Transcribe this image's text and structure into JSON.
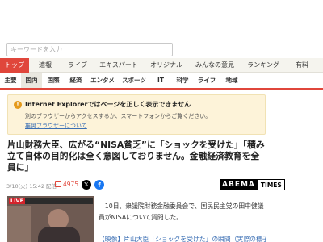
{
  "search": {
    "placeholder": "キーワードを入力"
  },
  "main_nav": {
    "items": [
      {
        "label": "トップ",
        "active": true
      },
      {
        "label": "速報",
        "active": false
      },
      {
        "label": "ライブ",
        "active": false
      },
      {
        "label": "エキスパート",
        "active": false
      },
      {
        "label": "オリジナル",
        "active": false
      },
      {
        "label": "みんなの意見",
        "active": false
      },
      {
        "label": "ランキング",
        "active": false
      },
      {
        "label": "有料",
        "active": false
      }
    ]
  },
  "sub_nav": {
    "items": [
      {
        "label": "主要",
        "active": false
      },
      {
        "label": "国内",
        "active": true
      },
      {
        "label": "国際",
        "active": false
      },
      {
        "label": "経済",
        "active": false
      },
      {
        "label": "エンタメ",
        "active": false
      },
      {
        "label": "スポーツ",
        "active": false
      },
      {
        "label": "IT",
        "active": false
      },
      {
        "label": "科学",
        "active": false
      },
      {
        "label": "ライフ",
        "active": false
      },
      {
        "label": "地域",
        "active": false
      }
    ]
  },
  "ie_notice": {
    "icon": "!",
    "title": "Internet Explorerではページを正しく表示できません",
    "desc": "別のブラウザーからアクセスするか、スマートフォンからご覧ください。",
    "link": "推奨ブラウザーについて"
  },
  "article": {
    "headline": "片山財務大臣、広がる“NISA貧乏”に「ショックを受けた」「積み立て自体の目的化は全く意図しておりません。金融経済教育を全員に」",
    "date": "3/10(火) 15:42 配信",
    "comment_count": "4975",
    "source_logo": {
      "main": "ABEMA",
      "sub": "TIMES"
    },
    "thumbnail_badge": "LIVE",
    "body": "　10日、衆議院財務金融委員会で、国民民主党の田中健議員がNISAについて質問した。",
    "related": "【映像】片山大臣「ショックを受けた」の瞬間（実際の様子）"
  },
  "colors": {
    "accent": "#e0463b",
    "notice_bg": "#fdf3d9",
    "link": "#3b6fb4"
  },
  "icons": {
    "comment": "comment-icon",
    "x": "x-share-icon",
    "facebook": "facebook-share-icon",
    "warning": "warning-icon"
  }
}
